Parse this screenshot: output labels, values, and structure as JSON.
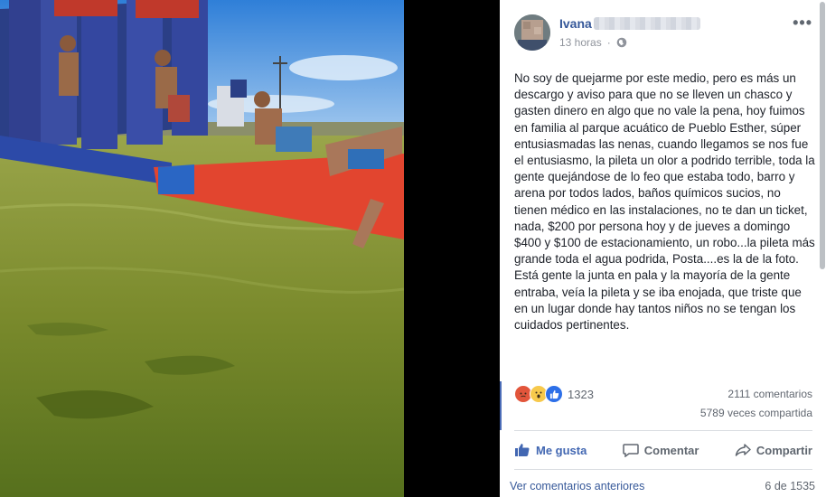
{
  "post": {
    "author": "Ivana",
    "time": "13 horas",
    "privacy_icon": "globe-icon",
    "text": "No soy de quejarme por este medio, pero es más un descargo y aviso para que no se lleven un chasco y gasten dinero en algo que no vale la pena, hoy fuimos en familia al parque acuático de Pueblo Esther, súper entusiasmadas las nenas, cuando llegamos se nos fue el entusiasmo, la pileta un olor a podrido terrible, toda la gente quejándose de lo feo que estaba todo, barro y arena por todos lados, baños químicos sucios, no tienen médico en las instalaciones, no te dan un ticket, nada, $200 por persona hoy y de jueves a domingo $400 y $100 de estacionamiento, un robo...la pileta más grande toda el agua podrida, Posta....es la de la foto. Está gente la junta en pala y la mayoría de la gente entraba, veía la pileta y se iba enojada, que triste que en un lugar donde hay tantos niños no se tengan los cuidados pertinentes."
  },
  "stats": {
    "reaction_icons": [
      "angry-icon",
      "wow-icon",
      "like-icon"
    ],
    "reaction_count": "1323",
    "comments": "2111 comentarios",
    "shares": "5789 veces compartida"
  },
  "actions": {
    "like": "Me gusta",
    "comment": "Comentar",
    "share": "Compartir"
  },
  "footer": {
    "previous_comments": "Ver comentarios anteriores",
    "count": "6 de 1535"
  },
  "colors": {
    "link": "#365899",
    "like_blue": "#4267b2",
    "water": "#7c8a2e"
  }
}
